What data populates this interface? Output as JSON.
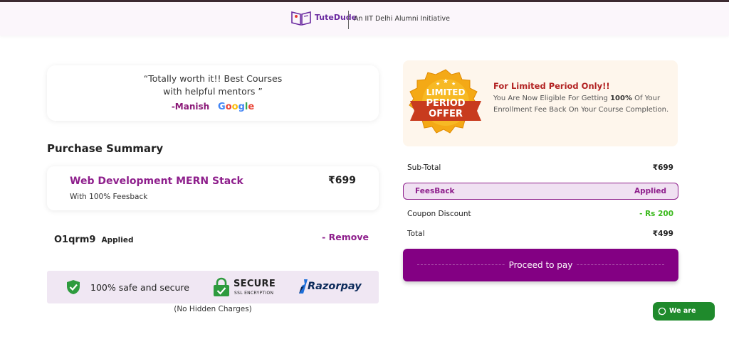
{
  "header": {
    "brand": "TuteDude",
    "tagline": "An IIT Delhi Alumni Initiative"
  },
  "testimonial": {
    "quote_line1": "“Totally worth it!! Best Courses",
    "quote_line2": "with helpful mentors ”",
    "author": "-Manish",
    "source_letters": [
      "G",
      "o",
      "o",
      "g",
      "l",
      "e"
    ]
  },
  "purchase": {
    "title": "Purchase Summary",
    "course_name": "Web Development MERN Stack",
    "course_sub": "With 100% Feesback",
    "course_price": "₹699"
  },
  "coupon": {
    "code": "O1qrm9",
    "status": "Applied",
    "remove_label": "- Remove"
  },
  "security": {
    "safe_text": "100% safe and secure",
    "ssl_main": "SECURE",
    "ssl_sub": "SSL ENCRYPTION",
    "gateway": "Razorpay",
    "no_hidden": "(No Hidden Charges)"
  },
  "offer": {
    "badge_line1": "LIMITED",
    "badge_line2": "PERIOD",
    "badge_line3": "OFFER",
    "title": "For Limited Period Only!!",
    "desc_part1": "You Are Now Eligible For Getting ",
    "desc_bold": "100%",
    "desc_part2": " Of Your Enrollment Fee Back On Your Course Completion."
  },
  "summary": {
    "subtotal_label": "Sub-Total",
    "subtotal_value": "₹699",
    "feesback_label": "FeesBack",
    "feesback_value": "Applied",
    "coupon_label": "Coupon Discount",
    "coupon_value": "- Rs 200",
    "total_label": "Total",
    "total_value": "₹499"
  },
  "pay_button": "Proceed to pay",
  "chat_button": "We are online",
  "colors": {
    "brand_purple": "#8e1f8c",
    "pay_button": "#830083",
    "discount_green": "#3cba1e",
    "chat_green": "#1f8a2c"
  }
}
